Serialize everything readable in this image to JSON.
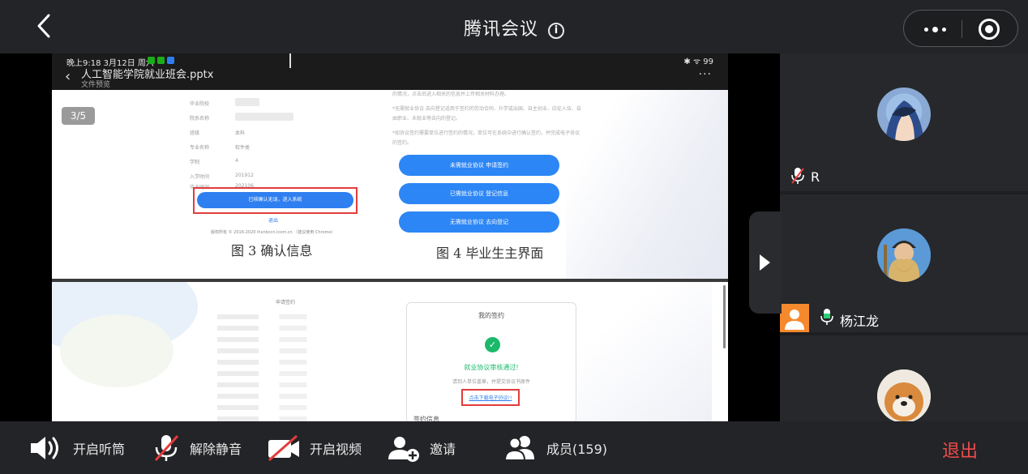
{
  "header": {
    "title": "腾讯会议",
    "info_glyph": "i",
    "more_icon": "more-dots-icon",
    "record_icon": "target-icon"
  },
  "shared_screen": {
    "status_bar": {
      "time": "晚上9:18 3月12日 周六",
      "right": "✱ ᯤ 99"
    },
    "document": {
      "title": "人工智能学院就业班会.pptx",
      "subtitle": "文件预览",
      "more": "···"
    },
    "page_indicator": "3/5",
    "slide1": {
      "form_labels": [
        "毕业院校",
        "院系名称",
        "班级",
        "专业名称",
        "学制",
        "入学时间",
        "毕业时间"
      ],
      "form_values": [
        "",
        "",
        "本科",
        "软件类",
        "4",
        "201912",
        "202106"
      ],
      "confirm_button": "已核确认无误，进入系统",
      "logout_link": "退出",
      "footer_tiny": "版权所有 © 2016-2020 ihxnbccn.lcom.cn  （建议使用 Chrome）",
      "figure3_caption": "图 3  确认信息",
      "figure4_caption": "图 4  毕业生主界面",
      "paragraph_top": "的情况，点击后进入相关的信息并上传相关材料办理。",
      "paragraph_mid": "*无需就业协议 去向登记适用于签约的劳动合同、升学或出国、自主创业、应征入伍、自由职业、未就业等去向的登记。",
      "paragraph_low": "*如协议签约需要单位进行签约的情况，单位可在系统中进行确认签约，并完成电子协议的签约。",
      "buttons": [
        "未需就业协议 申请签约",
        "已需就业协议 登记信息",
        "无需就业协议 去向登记"
      ]
    },
    "slide2": {
      "left_title": "申请签约",
      "phone_title": "我的签约",
      "success_text": "就业协议审核通过!",
      "hint_text": "请到人单位盖章，并提交协议书原件",
      "download_link": "点击下载电子协议!!",
      "bottom_text": "签约信息"
    }
  },
  "participants": [
    {
      "name": "R",
      "mic": "mic-muted-icon",
      "avatar": "avatar-anime-hood"
    },
    {
      "name": "杨江龙",
      "mic": "mic-active-icon",
      "avatar": "avatar-bearded-knight",
      "badge": "user-badge-icon"
    },
    {
      "name": "",
      "mic": "",
      "avatar": "avatar-shiba-dog"
    }
  ],
  "toolbar": {
    "speaker": "开启听筒",
    "unmute": "解除静音",
    "video": "开启视频",
    "invite": "邀请",
    "members": "成员(159)",
    "exit": "退出"
  },
  "colors": {
    "accent_blue": "#2f7ff0",
    "danger_red": "#f04b4b",
    "success_green": "#1bb96a",
    "badge_orange": "#f5892d"
  }
}
